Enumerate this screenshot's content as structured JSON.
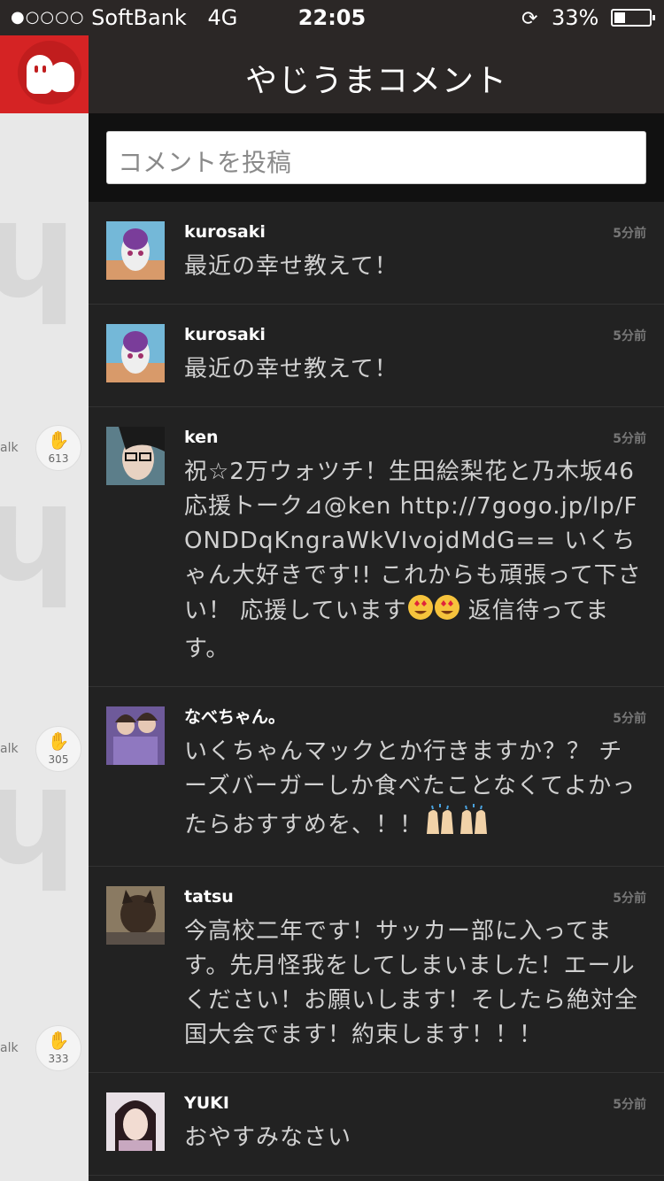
{
  "status_bar": {
    "carrier": "SoftBank",
    "network": "4G",
    "time": "22:05",
    "battery": "33%",
    "signal_dots": "●○○○○"
  },
  "header": {
    "title": "やじうまコメント"
  },
  "compose": {
    "placeholder": "コメントを投稿"
  },
  "side_panel": [
    {
      "label": "alk",
      "count": "613"
    },
    {
      "label": "alk",
      "count": "305"
    },
    {
      "label": "alk",
      "count": "333"
    }
  ],
  "comments": [
    {
      "user": "kurosaki",
      "time": "5分前",
      "text": "最近の幸せ教えて！"
    },
    {
      "user": "kurosaki",
      "time": "5分前",
      "text": "最近の幸せ教えて！"
    },
    {
      "user": "ken",
      "time": "5分前",
      "text": "祝☆2万ウォツチ！生田絵梨花と乃木坂46応援トーク⊿@ken  http://7gogo.jp/lp/FONDDqKngraWkVIvojdMdG==  いくちゃん大好きです!! これからも頑張って下さい！ 応援しています",
      "text_after": " 返信待ってます。"
    },
    {
      "user": "なべちゃん。",
      "time": "5分前",
      "text": "いくちゃんマックとか行きますか？？ チーズバーガーしか食べたことなくてよかったらおすすめを、！！"
    },
    {
      "user": "tatsu",
      "time": "5分前",
      "text": "今高校二年です！サッカー部に入ってます。先月怪我をしてしまいました！エールください！お願いします！そしたら絶対全国大会でます！約束します！！！"
    },
    {
      "user": "YUKI",
      "time": "5分前",
      "text": "おやすみなさい"
    }
  ]
}
